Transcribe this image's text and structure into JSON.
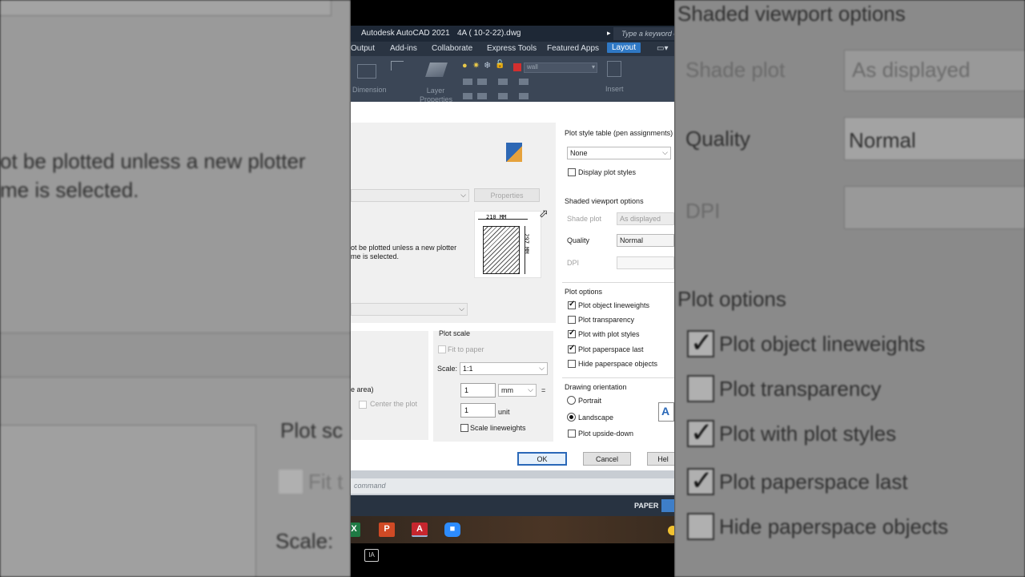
{
  "app": {
    "title": "Autodesk AutoCAD 2021",
    "filename": "4A ( 10-2-22).dwg",
    "search_placeholder": "Type a keyword or"
  },
  "ribbon_tabs": [
    "Output",
    "Add-ins",
    "Collaborate",
    "Express Tools",
    "Featured Apps",
    "Layout"
  ],
  "ribbon": {
    "dimension_label": "Dimension",
    "layer_properties_label": "Layer Properties",
    "layer_name": "wall",
    "insert_label": "Insert"
  },
  "dialog": {
    "plotter_message": "ot be plotted unless a new plotter\nme is selected.",
    "properties_button": "Properties",
    "paper_width": "210 MM",
    "paper_height": "297 MM",
    "plot_area_partial": "e area)",
    "center_the_plot": "Center the plot",
    "plot_style_table_title": "Plot style table (pen assignments)",
    "plot_style_value": "None",
    "display_plot_styles": "Display plot styles",
    "shaded_viewport_title": "Shaded viewport options",
    "shade_plot_label": "Shade plot",
    "shade_plot_value": "As displayed",
    "quality_label": "Quality",
    "quality_value": "Normal",
    "dpi_label": "DPI",
    "plot_options_title": "Plot options",
    "plot_options": [
      {
        "label": "Plot object lineweights",
        "checked": true
      },
      {
        "label": "Plot transparency",
        "checked": false
      },
      {
        "label": "Plot with plot styles",
        "checked": true
      },
      {
        "label": "Plot paperspace last",
        "checked": true
      },
      {
        "label": "Hide paperspace objects",
        "checked": false
      }
    ],
    "drawing_orientation_title": "Drawing orientation",
    "portrait": "Portrait",
    "landscape": "Landscape",
    "upside_down": "Plot upside-down",
    "plot_scale_title": "Plot scale",
    "fit_to_paper": "Fit to paper",
    "scale_label": "Scale:",
    "scale_value": "1:1",
    "scale_mm_value": "1",
    "scale_unit_combo": "mm",
    "equals": "=",
    "scale_unit_value": "1",
    "unit_label": "unit",
    "scale_lineweights": "Scale lineweights",
    "ok": "OK",
    "cancel": "Cancel",
    "help": "Hel"
  },
  "command_placeholder": "command",
  "status": {
    "paper": "PAPER"
  },
  "background_right": {
    "shaded_viewport_title": "Shaded viewport options",
    "shade_plot_label": "Shade plot",
    "shade_plot_value": "As displayed",
    "quality_label": "Quality",
    "quality_value": "Normal",
    "dpi_label": "DPI",
    "plot_options_title": "Plot options",
    "plot_options": [
      "Plot object lineweights",
      "Plot transparency",
      "Plot with plot styles",
      "Plot paperspace last",
      "Hide paperspace objects"
    ]
  },
  "background_left": {
    "message_line1": "ot be plotted unless a new plotter",
    "message_line2": "me is selected.",
    "plot_scale": "Plot sc",
    "fit": "Fit t",
    "scale": "Scale:"
  }
}
